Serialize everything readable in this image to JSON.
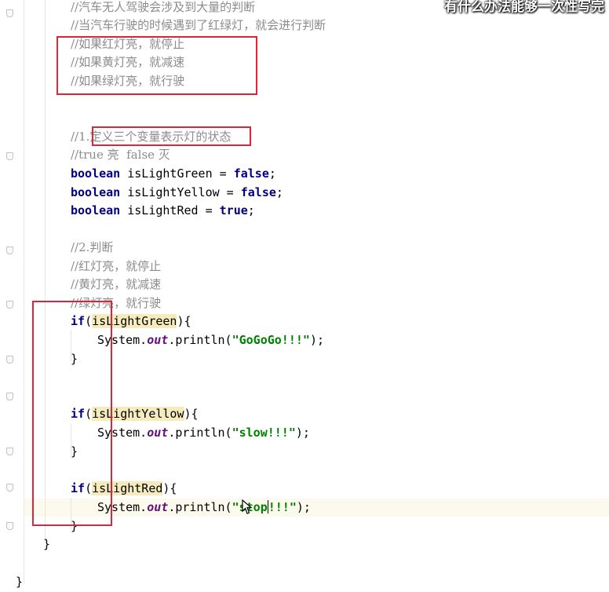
{
  "overlay": {
    "caption": "有什么办法能够一次性写完"
  },
  "comments": {
    "c1": "//汽车无人驾驶会涉及到大量的判断",
    "c2": "//当汽车行驶的时候遇到了红绿灯，就会进行判断",
    "c3": "//如果红灯亮，就停止",
    "c4": "//如果黄灯亮，就减速",
    "c5": "//如果绿灯亮，就行驶",
    "c6": "//1.定义三个变量表示灯的状态",
    "c7": "//true 亮  false 灭",
    "c8": "//2.判断",
    "c9": "//红灯亮，就停止",
    "c10": "//黄灯亮，就减速",
    "c11": "//绿灯亮，就行驶"
  },
  "code": {
    "kw_boolean": "boolean",
    "kw_false": "false",
    "kw_true": "true",
    "kw_if": "if",
    "var_green": "isLightGreen",
    "var_yellow": "isLightYellow",
    "var_red": "isLightRed",
    "assign": " = ",
    "semi": ";",
    "system": "System.",
    "out": "out",
    "println": ".println(",
    "close_call": ");",
    "open_paren": "(",
    "close_brace_open": "){",
    "close_brace": "}",
    "str_green": "\"GoGoGo!!!\"",
    "str_yellow": "\"slow!!!\"",
    "str_red_a": "\"stop",
    "str_red_b": "!!!\""
  },
  "colors": {
    "annotation_red": "#d9263a",
    "keyword": "#000080",
    "string": "#008000",
    "comment": "#8c8c8c"
  }
}
